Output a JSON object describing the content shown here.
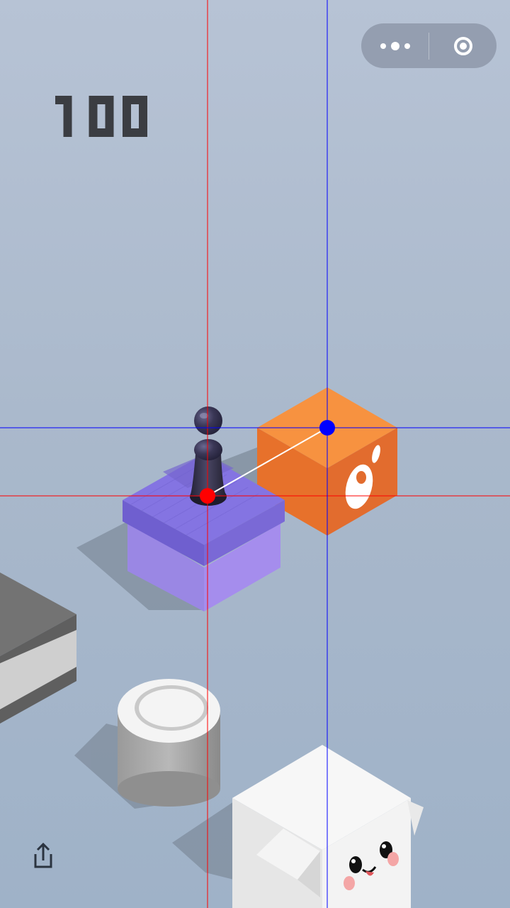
{
  "game": {
    "score": "100"
  },
  "capsule": {
    "more_icon": "more-dots-icon",
    "close_icon": "target-circle-icon"
  },
  "toolbar": {
    "share_icon": "share-upload-icon"
  },
  "colors": {
    "background_top": "#b7c3d5",
    "background_bottom": "#9fb2c8",
    "purple_block": "#8e7fe0",
    "orange_block": "#f3813a",
    "piece": "#2e2c45",
    "guide_red": "#ff0000",
    "guide_blue": "#0000ff"
  }
}
